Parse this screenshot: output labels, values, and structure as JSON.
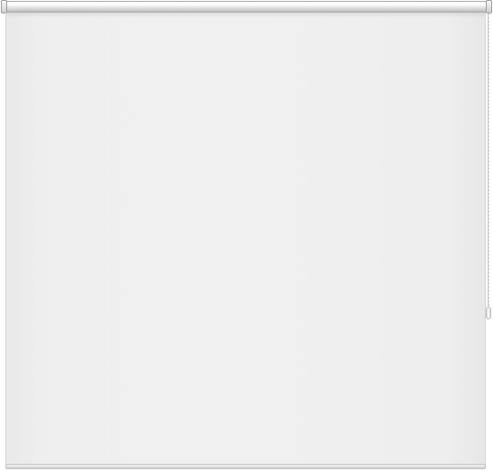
{
  "scene": {
    "subject": "roller blind",
    "colors": {
      "fabric": "#f0f0f0",
      "headrail": "#d9d9d9",
      "outline": "#a9a9a9",
      "background": "#ffffff"
    },
    "icons": {
      "headrail": "roller-headrail-icon",
      "chain": "control-chain-icon"
    }
  }
}
